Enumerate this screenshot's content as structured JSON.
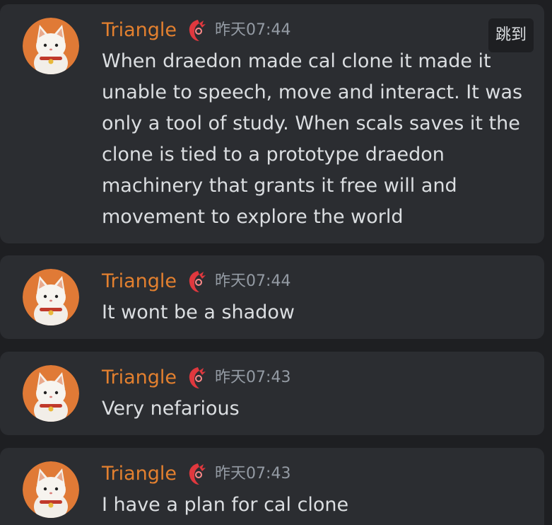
{
  "jump_button": {
    "label": "跳到"
  },
  "messages": [
    {
      "username": "Triangle",
      "timestamp": "昨天07:44",
      "text": "When draedon made cal clone it made it unable to speech, move and interact. It was only a tool of study. When scals saves it the clone is tied to a prototype draedon machinery that grants it free will and movement to explore the world"
    },
    {
      "username": "Triangle",
      "timestamp": "昨天07:44",
      "text": "It wont be a shadow"
    },
    {
      "username": "Triangle",
      "timestamp": "昨天07:43",
      "text": "Very nefarious"
    },
    {
      "username": "Triangle",
      "timestamp": "昨天07:43",
      "text": "I have a plan for cal clone"
    }
  ],
  "colors": {
    "background": "#1e1f22",
    "card": "#2b2d31",
    "username": "#e3802f",
    "timestamp": "#949ba4",
    "text": "#dbdee1",
    "role_icon": "#e0383e"
  },
  "icons": {
    "avatar": "white-cat-avatar",
    "role": "red-role-emblem-icon"
  }
}
